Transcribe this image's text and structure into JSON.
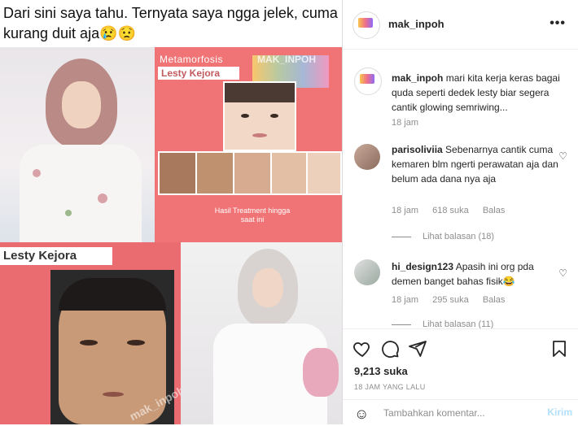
{
  "post_image": {
    "caption_text": "Dari sini saya tahu. Ternyata saya ngga jelek, cuma kurang duit aja😢😟",
    "meta_title": "Metamorfosis",
    "meta_name": "Lesty Kejora",
    "watermark_top": "MAK_INPOH",
    "treatment_text": "Hasil Treatment hingga saat ini",
    "lesty_label": "Lesty Kejora",
    "watermark_bottom": "mak_inpoh"
  },
  "header": {
    "username": "mak_inpoh",
    "more_icon": "more-options-icon"
  },
  "caption": {
    "username": "mak_inpoh",
    "text": "mari kita kerja keras bagai quda seperti dedek lesty biar segera cantik glowing semriwing...",
    "time": "18 jam"
  },
  "comments": [
    {
      "username": "parisoliviia",
      "text": "Sebenarnya cantik cuma kemaren blm ngerti perawatan aja dan belum ada dana nya aja",
      "time": "18 jam",
      "likes": "618 suka",
      "reply": "Balas",
      "view_replies": "Lihat balasan (18)"
    },
    {
      "username": "hi_design123",
      "text": "Apasih ini org pda demen banget bahas fisik😂",
      "time": "18 jam",
      "likes": "295 suka",
      "reply": "Balas",
      "view_replies": "Lihat balasan (11)"
    }
  ],
  "actions": {
    "likes_count": "9,213 suka",
    "posted_time": "18 JAM YANG LALU"
  },
  "add_comment": {
    "placeholder": "Tambahkan komentar...",
    "post_label": "Kirim"
  },
  "colors": {
    "pink_panel": "#f07476",
    "post_button": "#b2dffc",
    "meta_text": "#8e8e8e"
  }
}
